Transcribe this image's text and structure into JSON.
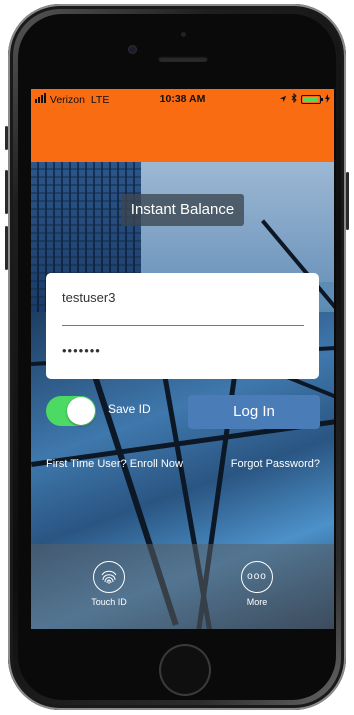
{
  "status_bar": {
    "carrier": "Verizon",
    "network": "LTE",
    "time": "10:38 AM",
    "battery_level": 0.8,
    "icons": [
      "location-arrow-icon",
      "bluetooth-icon",
      "battery-icon",
      "charging-icon"
    ]
  },
  "header": {
    "title": "Instant Balance"
  },
  "login": {
    "username": "testuser3",
    "password_mask": "•••••••"
  },
  "save_id": {
    "label": "Save ID",
    "enabled": true
  },
  "login_button": {
    "label": "Log In"
  },
  "links": {
    "enroll": "First Time User? Enroll Now",
    "forgot": "Forgot Password?"
  },
  "bottom_bar": {
    "touch_id_label": "Touch ID",
    "more_label": "More",
    "more_glyph": "ooo"
  },
  "colors": {
    "header": "#fa6c12",
    "toggle_on": "#4cd964",
    "login_button": "#4a7db8"
  }
}
